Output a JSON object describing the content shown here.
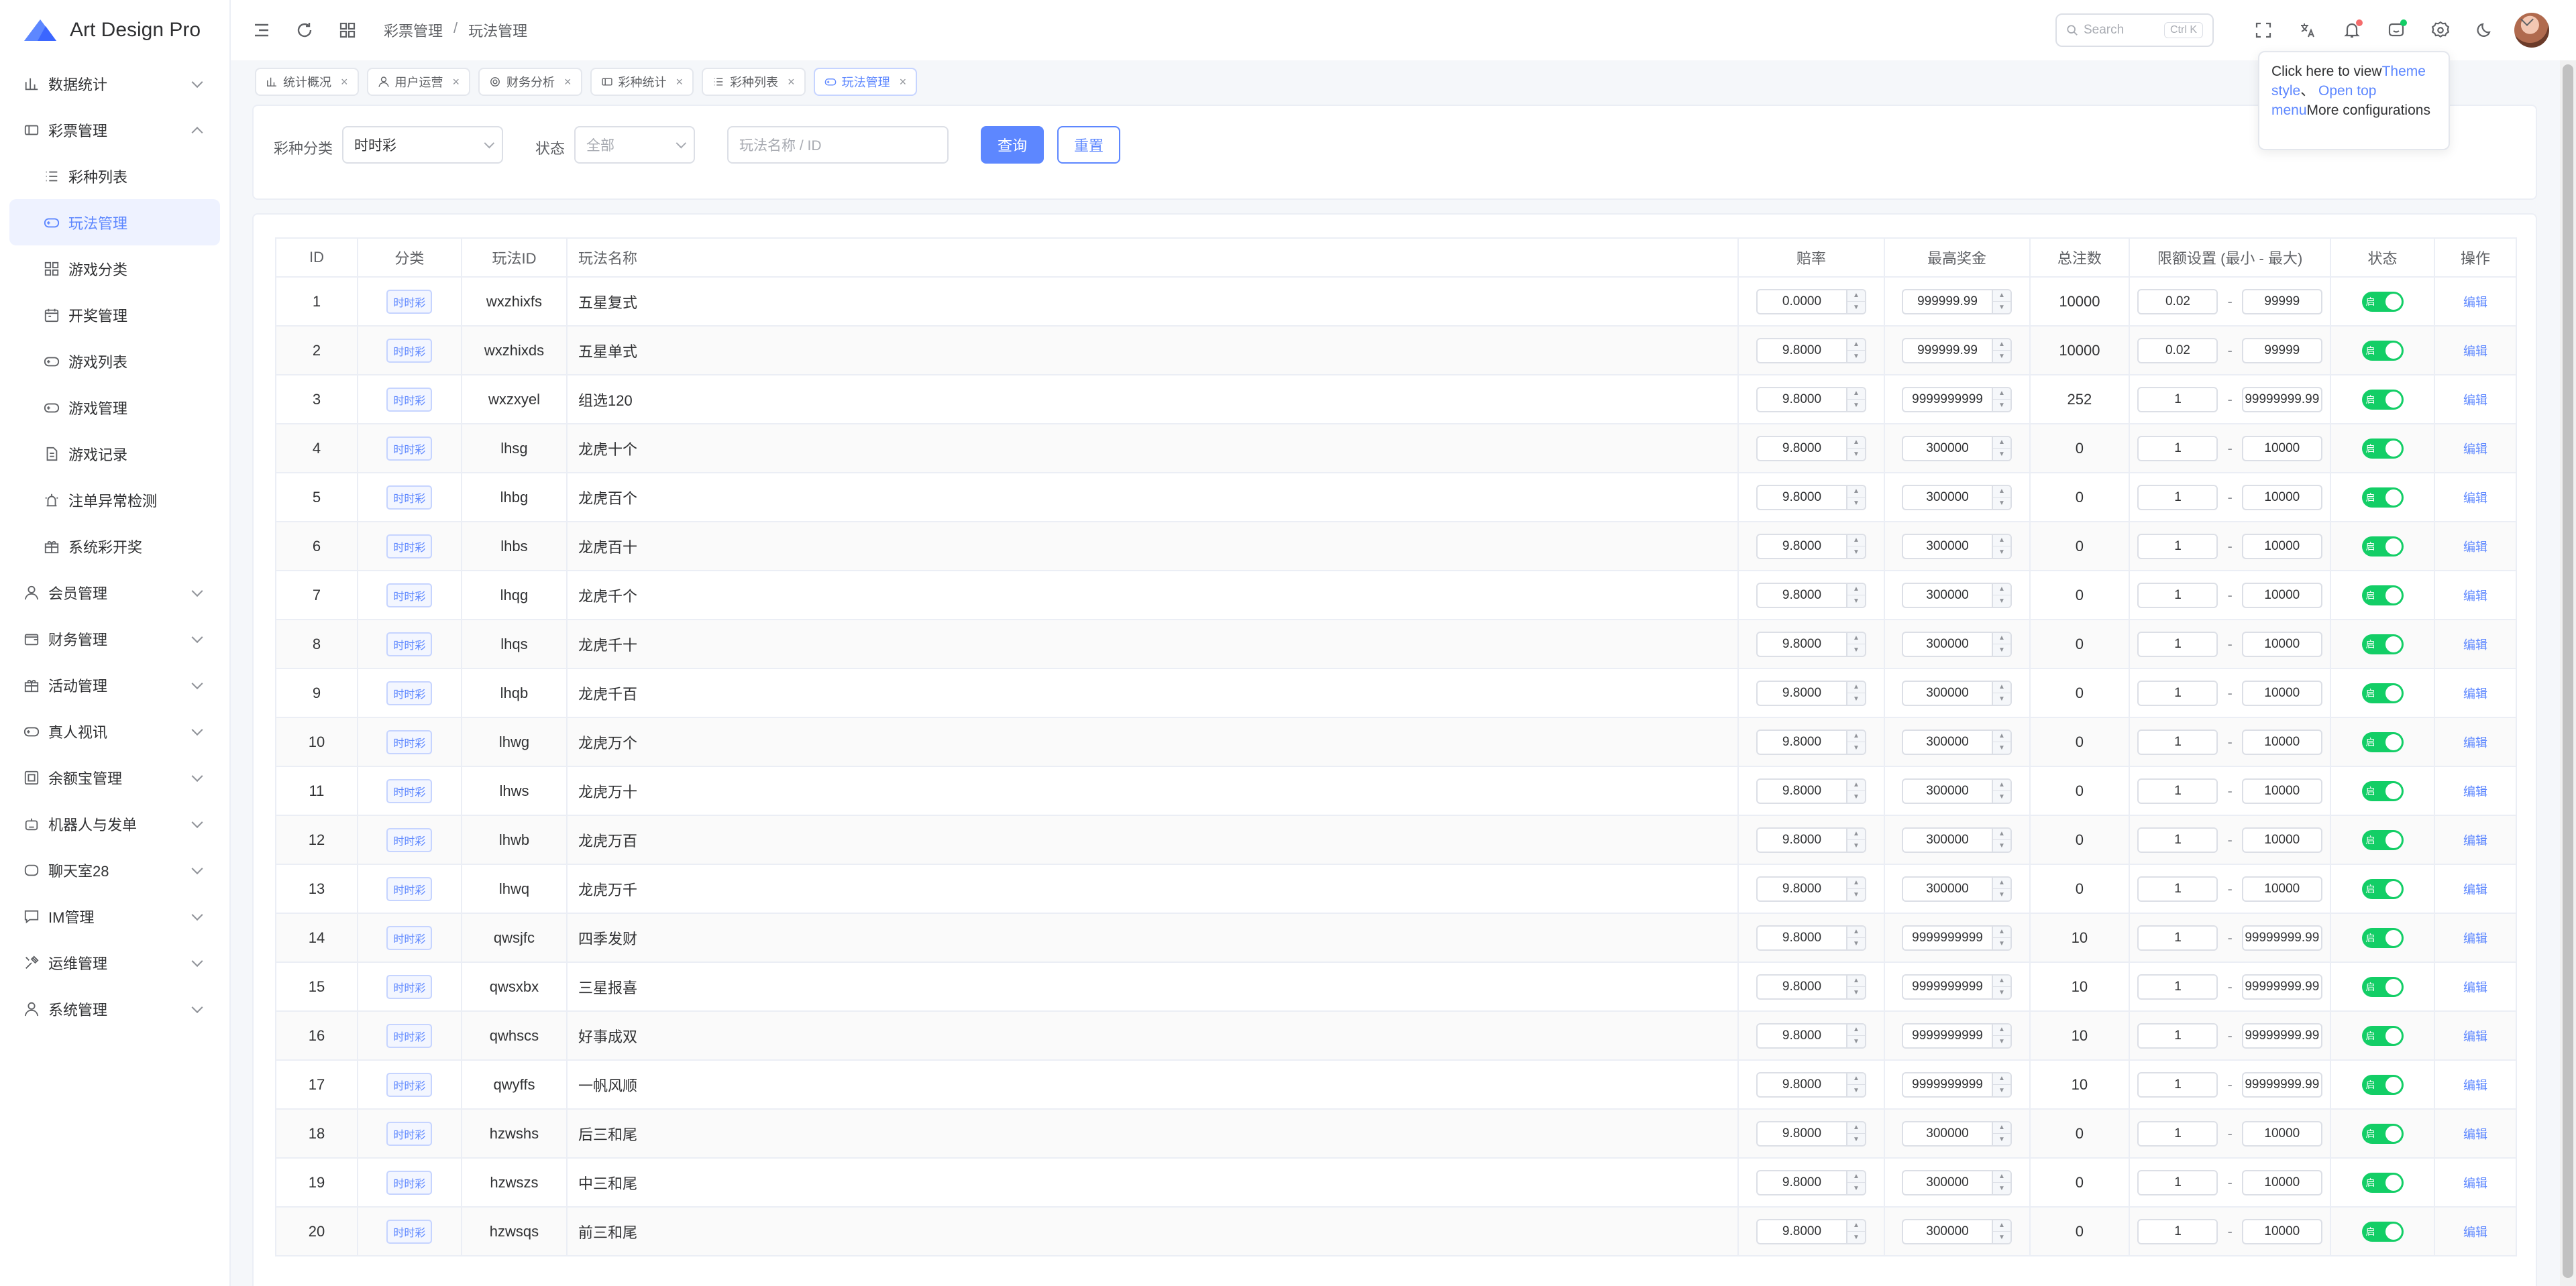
{
  "app": {
    "logo_text": "Art Design Pro"
  },
  "sidebar": {
    "items": [
      {
        "label": "数据统计",
        "icon": "chart-icon",
        "chevron": "down"
      },
      {
        "label": "彩票管理",
        "icon": "ticket-icon",
        "chevron": "up"
      },
      {
        "label": "彩种列表",
        "icon": "list-icon",
        "sub": true
      },
      {
        "label": "玩法管理",
        "icon": "gamepad-icon",
        "sub": true,
        "active": true
      },
      {
        "label": "游戏分类",
        "icon": "grid-icon",
        "sub": true
      },
      {
        "label": "开奖管理",
        "icon": "calendar-icon",
        "sub": true
      },
      {
        "label": "游戏列表",
        "icon": "gamepad-icon",
        "sub": true
      },
      {
        "label": "游戏管理",
        "icon": "gamepad-icon",
        "sub": true
      },
      {
        "label": "游戏记录",
        "icon": "document-icon",
        "sub": true
      },
      {
        "label": "注单异常检测",
        "icon": "alarm-icon",
        "sub": true
      },
      {
        "label": "系统彩开奖",
        "icon": "gift-icon",
        "sub": true
      },
      {
        "label": "会员管理",
        "icon": "user-icon",
        "chevron": "down"
      },
      {
        "label": "财务管理",
        "icon": "wallet-icon",
        "chevron": "down"
      },
      {
        "label": "活动管理",
        "icon": "gift-icon",
        "chevron": "down"
      },
      {
        "label": "真人视讯",
        "icon": "gamepad-icon",
        "chevron": "down"
      },
      {
        "label": "余额宝管理",
        "icon": "vault-icon",
        "chevron": "down"
      },
      {
        "label": "机器人与发单",
        "icon": "robot-icon",
        "chevron": "down"
      },
      {
        "label": "聊天室28",
        "icon": "chat-bot-icon",
        "chevron": "down"
      },
      {
        "label": "IM管理",
        "icon": "message-icon",
        "chevron": "down"
      },
      {
        "label": "运维管理",
        "icon": "tools-icon",
        "chevron": "down"
      },
      {
        "label": "系统管理",
        "icon": "user-icon",
        "chevron": "down"
      }
    ]
  },
  "header": {
    "breadcrumb": [
      "彩票管理",
      "玩法管理"
    ],
    "search_placeholder": "Search",
    "search_shortcut": "Ctrl K"
  },
  "tabs": [
    {
      "label": "统计概况",
      "icon": "chart-icon"
    },
    {
      "label": "用户运营",
      "icon": "user-icon"
    },
    {
      "label": "财务分析",
      "icon": "target-icon"
    },
    {
      "label": "彩种统计",
      "icon": "ticket-icon"
    },
    {
      "label": "彩种列表",
      "icon": "list-icon"
    },
    {
      "label": "玩法管理",
      "icon": "gamepad-icon",
      "active": true
    }
  ],
  "filter": {
    "category_label": "彩种分类",
    "category_value": "时时彩",
    "status_label": "状态",
    "status_value": "全部",
    "keyword_placeholder": "玩法名称 / ID",
    "query_button": "查询",
    "reset_button": "重置"
  },
  "table": {
    "headers": [
      "ID",
      "分类",
      "玩法ID",
      "玩法名称",
      "赔率",
      "最高奖金",
      "总注数",
      "限额设置 (最小 - 最大)",
      "状态",
      "操作"
    ],
    "switch_text": "启",
    "edit_text": "编辑",
    "rows": [
      {
        "id": "1",
        "cat": "时时彩",
        "pid": "wxzhixfs",
        "name": "五星复式",
        "odds": "0.0000",
        "max": "999999.99",
        "total": "10000",
        "min": "0.02",
        "lmax": "99999"
      },
      {
        "id": "2",
        "cat": "时时彩",
        "pid": "wxzhixds",
        "name": "五星单式",
        "odds": "9.8000",
        "max": "999999.99",
        "total": "10000",
        "min": "0.02",
        "lmax": "99999"
      },
      {
        "id": "3",
        "cat": "时时彩",
        "pid": "wxzxyel",
        "name": "组选120",
        "odds": "9.8000",
        "max": "9999999999",
        "total": "252",
        "min": "1",
        "lmax": "99999999.99"
      },
      {
        "id": "4",
        "cat": "时时彩",
        "pid": "lhsg",
        "name": "龙虎十个",
        "odds": "9.8000",
        "max": "300000",
        "total": "0",
        "min": "1",
        "lmax": "10000"
      },
      {
        "id": "5",
        "cat": "时时彩",
        "pid": "lhbg",
        "name": "龙虎百个",
        "odds": "9.8000",
        "max": "300000",
        "total": "0",
        "min": "1",
        "lmax": "10000"
      },
      {
        "id": "6",
        "cat": "时时彩",
        "pid": "lhbs",
        "name": "龙虎百十",
        "odds": "9.8000",
        "max": "300000",
        "total": "0",
        "min": "1",
        "lmax": "10000"
      },
      {
        "id": "7",
        "cat": "时时彩",
        "pid": "lhqg",
        "name": "龙虎千个",
        "odds": "9.8000",
        "max": "300000",
        "total": "0",
        "min": "1",
        "lmax": "10000"
      },
      {
        "id": "8",
        "cat": "时时彩",
        "pid": "lhqs",
        "name": "龙虎千十",
        "odds": "9.8000",
        "max": "300000",
        "total": "0",
        "min": "1",
        "lmax": "10000"
      },
      {
        "id": "9",
        "cat": "时时彩",
        "pid": "lhqb",
        "name": "龙虎千百",
        "odds": "9.8000",
        "max": "300000",
        "total": "0",
        "min": "1",
        "lmax": "10000"
      },
      {
        "id": "10",
        "cat": "时时彩",
        "pid": "lhwg",
        "name": "龙虎万个",
        "odds": "9.8000",
        "max": "300000",
        "total": "0",
        "min": "1",
        "lmax": "10000"
      },
      {
        "id": "11",
        "cat": "时时彩",
        "pid": "lhws",
        "name": "龙虎万十",
        "odds": "9.8000",
        "max": "300000",
        "total": "0",
        "min": "1",
        "lmax": "10000"
      },
      {
        "id": "12",
        "cat": "时时彩",
        "pid": "lhwb",
        "name": "龙虎万百",
        "odds": "9.8000",
        "max": "300000",
        "total": "0",
        "min": "1",
        "lmax": "10000"
      },
      {
        "id": "13",
        "cat": "时时彩",
        "pid": "lhwq",
        "name": "龙虎万千",
        "odds": "9.8000",
        "max": "300000",
        "total": "0",
        "min": "1",
        "lmax": "10000"
      },
      {
        "id": "14",
        "cat": "时时彩",
        "pid": "qwsjfc",
        "name": "四季发财",
        "odds": "9.8000",
        "max": "9999999999",
        "total": "10",
        "min": "1",
        "lmax": "99999999.99"
      },
      {
        "id": "15",
        "cat": "时时彩",
        "pid": "qwsxbx",
        "name": "三星报喜",
        "odds": "9.8000",
        "max": "9999999999",
        "total": "10",
        "min": "1",
        "lmax": "99999999.99"
      },
      {
        "id": "16",
        "cat": "时时彩",
        "pid": "qwhscs",
        "name": "好事成双",
        "odds": "9.8000",
        "max": "9999999999",
        "total": "10",
        "min": "1",
        "lmax": "99999999.99"
      },
      {
        "id": "17",
        "cat": "时时彩",
        "pid": "qwyffs",
        "name": "一帆风顺",
        "odds": "9.8000",
        "max": "9999999999",
        "total": "10",
        "min": "1",
        "lmax": "99999999.99"
      },
      {
        "id": "18",
        "cat": "时时彩",
        "pid": "hzwshs",
        "name": "后三和尾",
        "odds": "9.8000",
        "max": "300000",
        "total": "0",
        "min": "1",
        "lmax": "10000"
      },
      {
        "id": "19",
        "cat": "时时彩",
        "pid": "hzwszs",
        "name": "中三和尾",
        "odds": "9.8000",
        "max": "300000",
        "total": "0",
        "min": "1",
        "lmax": "10000"
      },
      {
        "id": "20",
        "cat": "时时彩",
        "pid": "hzwsqs",
        "name": "前三和尾",
        "odds": "9.8000",
        "max": "300000",
        "total": "0",
        "min": "1",
        "lmax": "10000"
      }
    ]
  },
  "tooltip": {
    "t1": "Click here to view",
    "t2": "Theme style",
    "t3": "、",
    "t4": "Open top menu",
    "t5": "More configurations"
  },
  "colors": {
    "accent": "#5d87ff",
    "switch_on": "#13ce66"
  }
}
